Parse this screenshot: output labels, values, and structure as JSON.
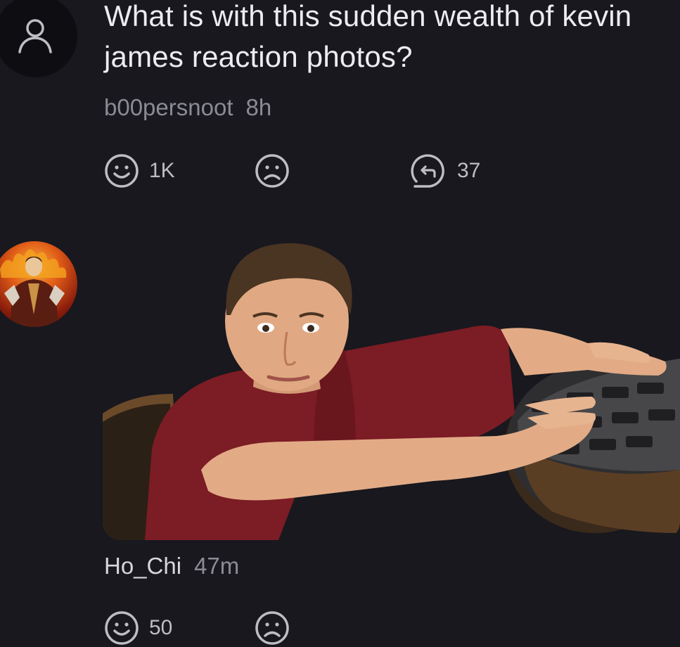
{
  "post": {
    "title": "What is with this sudden wealth of kevin james reaction photos?",
    "author": "b00persnoot",
    "time": "8h",
    "avatar_icon": "user-outline-icon",
    "actions": {
      "like_icon": "smile-icon",
      "like_count": "1K",
      "dislike_icon": "frown-icon",
      "reply_icon": "reply-icon",
      "reply_count": "37"
    }
  },
  "comment": {
    "author": "Ho_Chi",
    "time": "47m",
    "image_alt": "Man climbing out of a manhole",
    "actions": {
      "like_icon": "smile-icon",
      "like_count": "50",
      "dislike_icon": "frown-icon"
    }
  },
  "colors": {
    "background": "#18181e",
    "text_primary": "#ececf1",
    "text_secondary": "#8b8b94",
    "icon": "#bdbdc4"
  }
}
